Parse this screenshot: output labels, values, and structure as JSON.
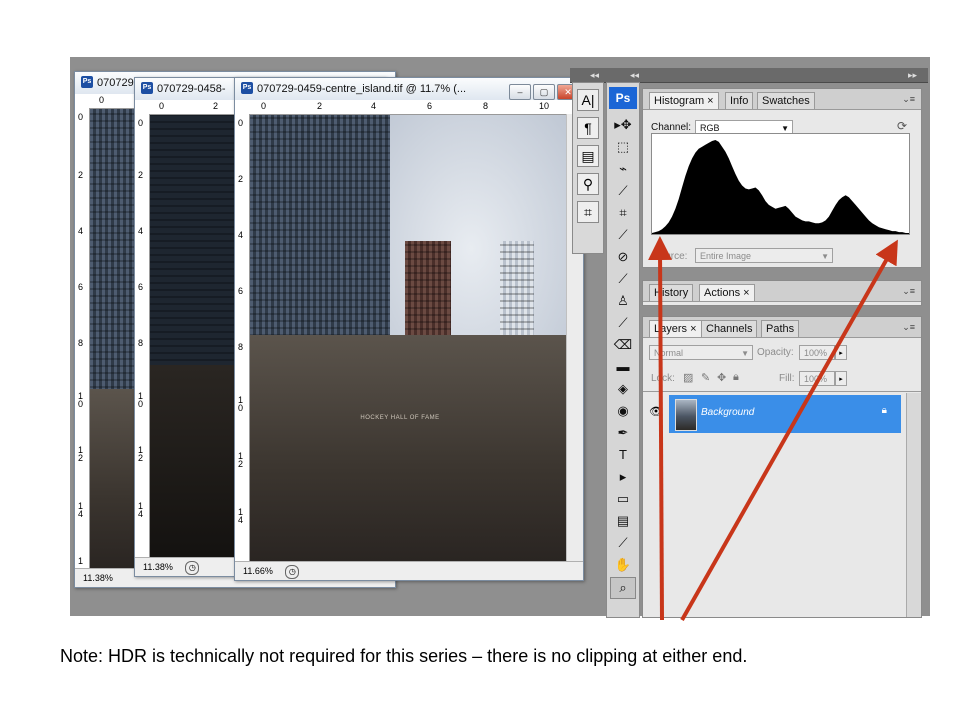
{
  "docs": {
    "back": {
      "title": "070729",
      "zoom": "11.38%",
      "ruler_h": [
        "0"
      ],
      "ruler_v": [
        "0",
        "2",
        "4",
        "6",
        "8",
        "1\n0",
        "1\n2",
        "1\n4",
        "1"
      ]
    },
    "middle": {
      "title": "070729-0458-",
      "zoom": "11.38%",
      "ruler_h": [
        "0",
        "2"
      ],
      "ruler_v": [
        "0",
        "2",
        "4",
        "6",
        "8",
        "1\n0",
        "1\n2",
        "1\n4"
      ]
    },
    "front": {
      "title": "070729-0459-centre_island.tif @ 11.7% (...",
      "zoom": "11.66%",
      "ruler_h": [
        "0",
        "2",
        "4",
        "6",
        "8",
        "10"
      ],
      "ruler_v": [
        "0",
        "2",
        "4",
        "6",
        "8",
        "1\n0",
        "1\n2",
        "1\n4"
      ]
    }
  },
  "photo_sign": "HOCKEY HALL OF FAME",
  "toolbox": {
    "logo": "Ps",
    "tools": [
      "▸✥",
      "⬚",
      "⌁",
      "⟋",
      "⌗",
      "⟋",
      "⊘",
      "⟋",
      "♙",
      "⟋",
      "⌫",
      "▬",
      "◈",
      "◉",
      "✒",
      "T",
      "▸",
      "▭",
      "▤",
      "⟋",
      "✋",
      "⌕"
    ]
  },
  "char_palette": {
    "items": [
      "A|",
      "¶",
      "▤",
      "⚲",
      "⌗"
    ]
  },
  "histogram_panel": {
    "tabs": [
      "Histogram ×",
      "Info",
      "Swatches"
    ],
    "channel_label": "Channel:",
    "channel_value": "RGB",
    "source_label": "Source:",
    "source_value": "Entire Image",
    "histogram": [
      1,
      2,
      3,
      5,
      8,
      12,
      18,
      26,
      36,
      48,
      60,
      70,
      78,
      84,
      88,
      90,
      92,
      94,
      96,
      97,
      95,
      90,
      85,
      78,
      70,
      62,
      55,
      50,
      47,
      46,
      47,
      48,
      45,
      40,
      34,
      30,
      28,
      26,
      27,
      28,
      29,
      26,
      22,
      18,
      16,
      14,
      13,
      13,
      12,
      11,
      11,
      12,
      14,
      18,
      24,
      30,
      35,
      38,
      40,
      38,
      34,
      30,
      26,
      22,
      18,
      14,
      11,
      9,
      7,
      6,
      5,
      4,
      3,
      3,
      2,
      2,
      1,
      1
    ]
  },
  "history_panel": {
    "tabs": [
      "History",
      "Actions ×"
    ]
  },
  "layers_panel": {
    "tabs": [
      "Layers ×",
      "Channels",
      "Paths"
    ],
    "blend_mode": "Normal",
    "opacity_label": "Opacity:",
    "opacity_value": "100%",
    "lock_label": "Lock:",
    "fill_label": "Fill:",
    "fill_value": "100%",
    "layer_name": "Background"
  },
  "note": "Note: HDR is technically not required for this series – there is no clipping at either end.",
  "colors": {
    "arrow": "#c8361a",
    "layer_selected": "#3a8ee8",
    "ps_blue": "#1b66d6"
  }
}
